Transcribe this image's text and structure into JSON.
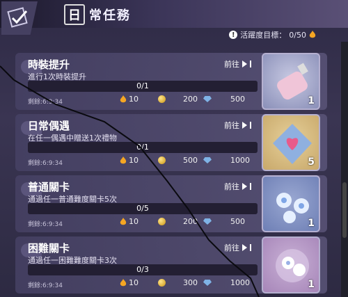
{
  "header": {
    "title_glyph": "日",
    "title_rest": "常任務"
  },
  "activity": {
    "label": "活躍度目標：",
    "value": "0/50"
  },
  "tasks": [
    {
      "name": "時裝提升",
      "desc": "進行1次時裝提升",
      "progress": "0/1",
      "progress_fraction": 0,
      "remain": "剩餘:6:9:34",
      "flame": "10",
      "coin": "200",
      "gem": "500",
      "goto": "前往",
      "item_count": "1",
      "item_icon": "perfume-bottle-icon"
    },
    {
      "name": "日常偶遇",
      "desc": "在任一偶遇中贈送1次禮物",
      "progress": "0/1",
      "progress_fraction": 0,
      "remain": "剩餘:6:9:34",
      "flame": "10",
      "coin": "500",
      "gem": "1000",
      "goto": "前往",
      "item_count": "5",
      "item_icon": "heart-crystal-icon"
    },
    {
      "name": "普通關卡",
      "desc": "通過任一普通難度關卡5次",
      "progress": "0/5",
      "progress_fraction": 0,
      "remain": "剩餘:6:9:34",
      "flame": "10",
      "coin": "200",
      "gem": "500",
      "goto": "前往",
      "item_count": "1",
      "item_icon": "blue-flowers-icon"
    },
    {
      "name": "困難關卡",
      "desc": "通過任一困難難度關卡3次",
      "progress": "0/3",
      "progress_fraction": 0,
      "remain": "剩餘:6:9:34",
      "flame": "10",
      "coin": "300",
      "gem": "1000",
      "goto": "前往",
      "item_count": "1",
      "item_icon": "pink-flowers-icon"
    }
  ],
  "colors": {
    "accent": "#6b63a0",
    "card": "#4a4466",
    "flame": "#f5a623"
  }
}
